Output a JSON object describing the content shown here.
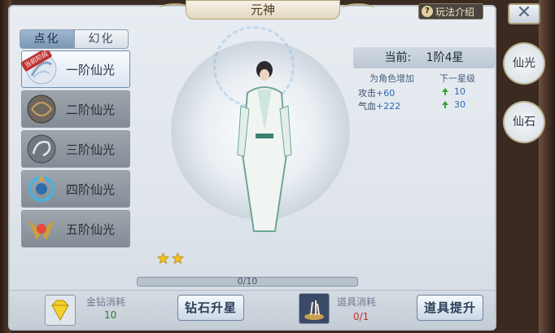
{
  "window": {
    "title": "元神",
    "help_label": "玩法介绍",
    "close_glyph": "✕"
  },
  "tabs": [
    {
      "label": "点化",
      "active": true
    },
    {
      "label": "幻化",
      "active": false
    }
  ],
  "list": {
    "badge": "当前阶段",
    "items": [
      {
        "label": "一阶仙光",
        "active": true,
        "icon": "light-orb-icon"
      },
      {
        "label": "二阶仙光",
        "active": false,
        "icon": "ring-icon"
      },
      {
        "label": "三阶仙光",
        "active": false,
        "icon": "swirl-icon"
      },
      {
        "label": "四阶仙光",
        "active": false,
        "icon": "flame-ring-icon"
      },
      {
        "label": "五阶仙光",
        "active": false,
        "icon": "winged-icon"
      }
    ]
  },
  "info": {
    "current_label": "当前:",
    "current_value": "1阶4星",
    "col_role": "为角色增加",
    "col_next": "下一星级",
    "stats": [
      {
        "name": "攻击",
        "value": "+60",
        "next": "10"
      },
      {
        "name": "气血",
        "value": "+222",
        "next": "30"
      }
    ]
  },
  "stars": {
    "filled": 2
  },
  "progress": {
    "current": 0,
    "max": 10,
    "text": "0/10"
  },
  "costs": {
    "diamond_label": "金钻消耗",
    "diamond_value": "10",
    "item_label": "道具消耗",
    "item_value": "0/1"
  },
  "buttons": {
    "diamond_upgrade": "钻石升星",
    "item_upgrade": "道具提升"
  },
  "side": {
    "btn1": "仙光",
    "btn2": "仙石"
  },
  "colors": {
    "accent": "#4b8ad0",
    "gold": "#e6b820",
    "frame": "#b6a47a"
  }
}
